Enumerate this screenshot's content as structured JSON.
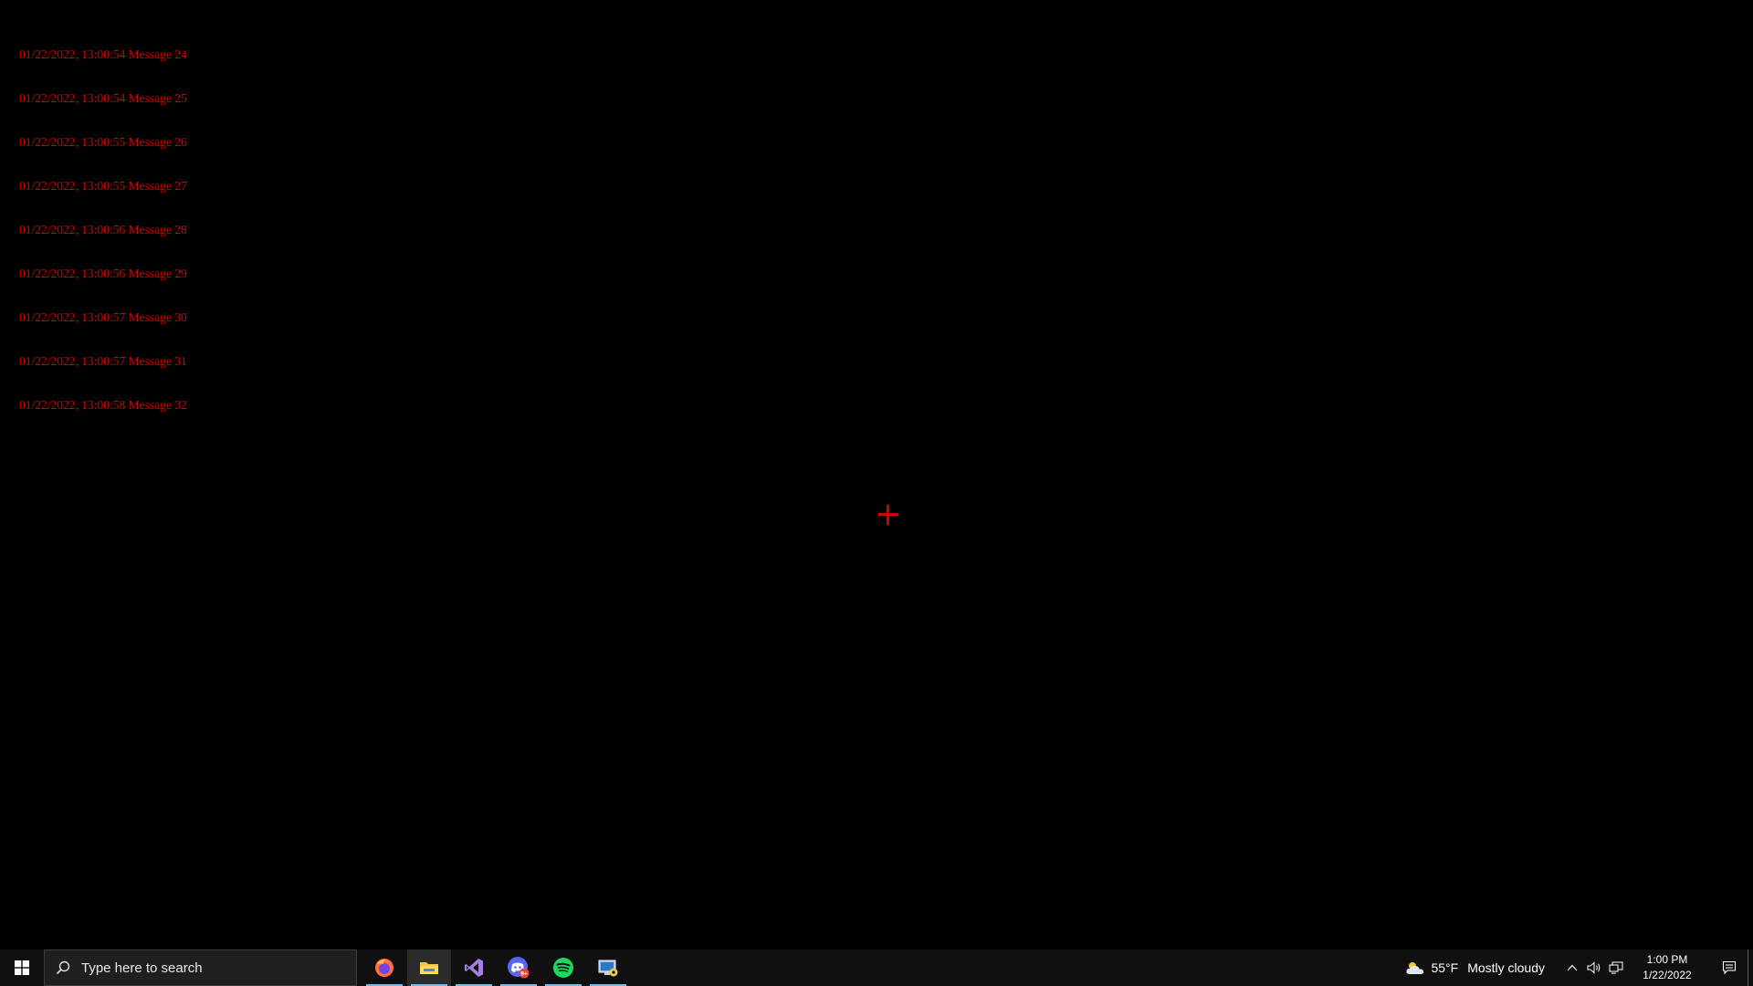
{
  "log": {
    "lines": [
      "01/22/2022, 13:00:54 Message 24",
      "01/22/2022, 13:00:54 Message 25",
      "01/22/2022, 13:00:55 Message 26",
      "01/22/2022, 13:00:55 Message 27",
      "01/22/2022, 13:00:56 Message 28",
      "01/22/2022, 13:00:56 Message 29",
      "01/22/2022, 13:00:57 Message 30",
      "01/22/2022, 13:00:57 Message 31",
      "01/22/2022, 13:00:58 Message 32"
    ],
    "color": "#d40000"
  },
  "taskbar": {
    "search_placeholder": "Type here to search",
    "apps": [
      {
        "name": "firefox-icon",
        "active": false,
        "running": true
      },
      {
        "name": "file-explorer-icon",
        "active": true,
        "running": true
      },
      {
        "name": "visual-studio-icon",
        "active": false,
        "running": true
      },
      {
        "name": "discord-icon",
        "active": false,
        "running": true,
        "badge": "9+"
      },
      {
        "name": "spotify-icon",
        "active": false,
        "running": true
      },
      {
        "name": "control-panel-icon",
        "active": false,
        "running": true
      }
    ],
    "accent_color": "#76b9ed"
  },
  "tray": {
    "weather_temp": "55°F",
    "weather_desc": "Mostly cloudy",
    "time": "1:00 PM",
    "date": "1/22/2022"
  }
}
